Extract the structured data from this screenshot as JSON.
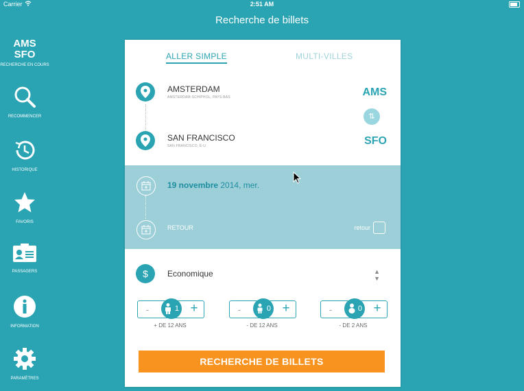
{
  "status": {
    "carrier": "Carrier",
    "time": "2:51 AM"
  },
  "nav": {
    "title": "Recherche de billets"
  },
  "sidebar": {
    "codes": "AMS\nSFO",
    "origin_code": "AMS",
    "dest_code": "SFO",
    "status": "RECHERCHE EN COURS",
    "items": [
      {
        "label": "RECOMMENCER",
        "icon": "search-icon"
      },
      {
        "label": "HISTORIQUE",
        "icon": "history-icon"
      },
      {
        "label": "FAVORIS",
        "icon": "star-icon"
      },
      {
        "label": "PASSAGERS",
        "icon": "passengers-icon"
      },
      {
        "label": "INFORMATION",
        "icon": "info-icon"
      },
      {
        "label": "PARAMÈTRES",
        "icon": "gear-icon"
      }
    ]
  },
  "tabs": {
    "one_way": "ALLER SIMPLE",
    "multi_city": "MULTI-VILLES"
  },
  "origin": {
    "name": "AMSTERDAM",
    "sub": "AMSTERDAM-SCHIPHOL, PAYS-BAS",
    "code": "AMS"
  },
  "destination": {
    "name": "SAN FRANCISCO",
    "sub": "SAN FRANCISCO, É-U",
    "code": "SFO"
  },
  "dates": {
    "departure_day": "19 novembre",
    "departure_rest": " 2014, mer.",
    "return_label": "RETOUR",
    "return_toggle_label": "retour"
  },
  "cabin": {
    "value": "Economique"
  },
  "passengers": [
    {
      "label": "+ DE 12 ANS",
      "count": "1",
      "icon": "adult-icon"
    },
    {
      "label": "- DE 12 ANS",
      "count": "0",
      "icon": "child-icon"
    },
    {
      "label": "- DE 2 ANS",
      "count": "0",
      "icon": "infant-icon"
    }
  ],
  "stepper": {
    "minus": "-",
    "plus": "+"
  },
  "search_button": "RECHERCHE DE BILLETS",
  "colors": {
    "primary": "#2aa4b3",
    "accent": "#f7931e",
    "date_band": "#9ccfd8"
  }
}
